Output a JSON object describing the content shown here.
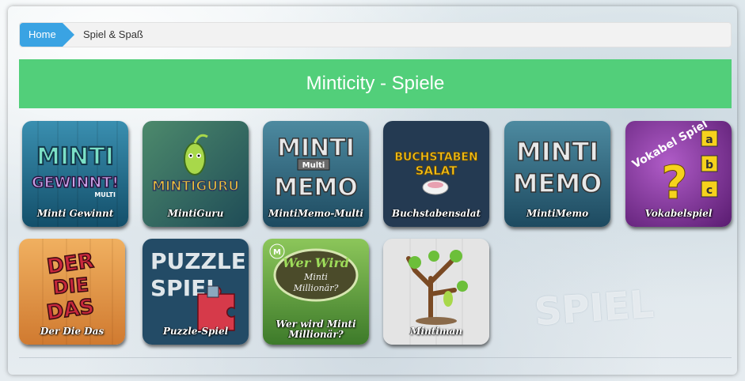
{
  "breadcrumb": {
    "home_label": "Home",
    "current_label": "Spiel & Spaß"
  },
  "header": {
    "title": "Minticity - Spiele"
  },
  "games": [
    {
      "name": "Minti Gewinnt",
      "logo_line1": "MINTI",
      "logo_line2": "GEWINNT!",
      "logo_small": "MULTI",
      "color": "#1e6f8e"
    },
    {
      "name": "MintiGuru",
      "logo_line1": "MINTIGURU",
      "color": "#2d6b6a"
    },
    {
      "name": "MintiMemo-Multi",
      "logo_line1": "MINTI",
      "logo_line2": "MEMO",
      "logo_small": "Multi",
      "color": "#2a5f76"
    },
    {
      "name": "Buchstabensalat",
      "logo_line1": "BUCHSTABEN",
      "logo_line2": "SALAT",
      "color": "#23374d"
    },
    {
      "name": "MintiMemo",
      "logo_line1": "MINTI",
      "logo_line2": "MEMO",
      "color": "#2a5f76"
    },
    {
      "name": "Vokabelspiel",
      "logo_line1": "Vokabel Spiel",
      "logo_letters": [
        "a",
        "b",
        "c"
      ],
      "logo_mark": "?",
      "color": "#7b2c93"
    },
    {
      "name": "Der Die Das",
      "logo_line1": "DER",
      "logo_line2": "DIE",
      "logo_line3": "DAS",
      "color": "#e4953f"
    },
    {
      "name": "Puzzle-Spiel",
      "logo_line1": "PUZZLE",
      "logo_line2": "SPIEL",
      "color": "#23465f"
    },
    {
      "name": "Wer wird Minti Millionär?",
      "name_line1": "Wer wird Minti",
      "name_line2": "Millionär?",
      "logo_line1": "Wer Wird",
      "logo_line2": "Minti",
      "logo_line3": "Millionär?",
      "logo_badge": "M",
      "color": "#5a9a3a"
    },
    {
      "name": "Mintiman",
      "color": "#dcdcdc"
    }
  ],
  "background": {
    "word": "SPIEL"
  }
}
